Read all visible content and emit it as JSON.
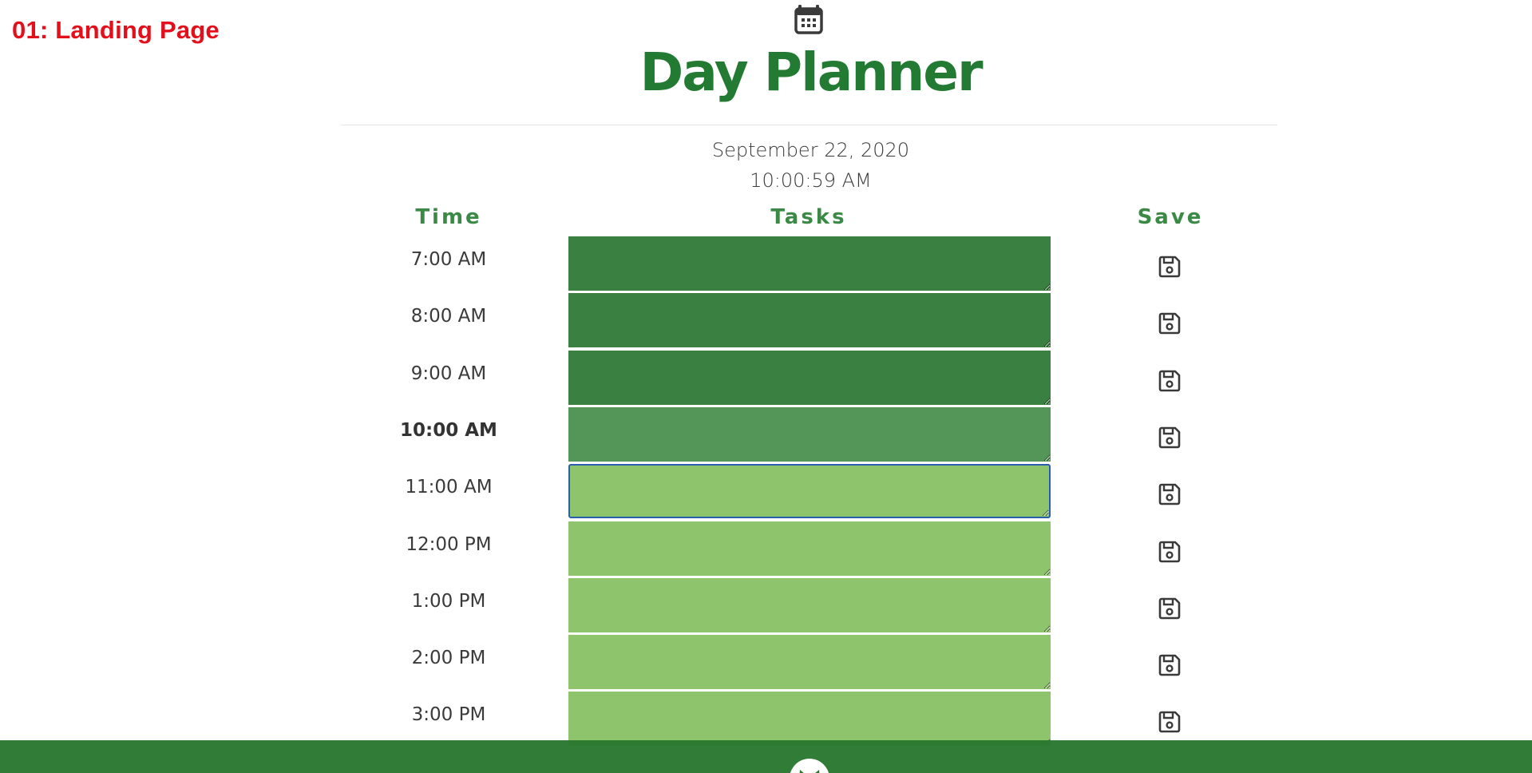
{
  "screen_label": "01: Landing Page",
  "header": {
    "title": "Day Planner",
    "icon": "calendar-icon"
  },
  "current": {
    "date": "September 22, 2020",
    "time": "10:00:59 AM"
  },
  "columns": {
    "time": "Time",
    "tasks": "Tasks",
    "save": "Save"
  },
  "hours": [
    {
      "label": "7:00 AM",
      "state": "past",
      "task": ""
    },
    {
      "label": "8:00 AM",
      "state": "past",
      "task": ""
    },
    {
      "label": "9:00 AM",
      "state": "past",
      "task": ""
    },
    {
      "label": "10:00 AM",
      "state": "present",
      "task": ""
    },
    {
      "label": "11:00 AM",
      "state": "future",
      "task": "",
      "focused": true
    },
    {
      "label": "12:00 PM",
      "state": "future",
      "task": ""
    },
    {
      "label": "1:00 PM",
      "state": "future",
      "task": ""
    },
    {
      "label": "2:00 PM",
      "state": "future",
      "task": ""
    },
    {
      "label": "3:00 PM",
      "state": "future",
      "task": ""
    }
  ],
  "colors": {
    "title": "#237a32",
    "label": "#e3101c",
    "past": "#3a8041",
    "present": "#539657",
    "future": "#8ec56c",
    "footer": "#2a7830"
  },
  "footer": {
    "icon": "github-icon"
  }
}
